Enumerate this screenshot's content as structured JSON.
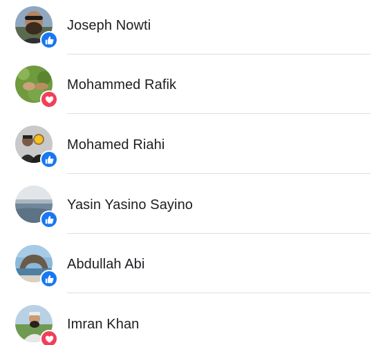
{
  "people": [
    {
      "name": "Joseph Nowti",
      "reaction": "like-icon"
    },
    {
      "name": "Mohammed Rafik",
      "reaction": "love-icon"
    },
    {
      "name": "Mohamed Riahi",
      "reaction": "like-icon"
    },
    {
      "name": "Yasin Yasino Sayino",
      "reaction": "like-icon"
    },
    {
      "name": "Abdullah Abi",
      "reaction": "like-icon"
    },
    {
      "name": "Imran Khan",
      "reaction": "love-icon"
    }
  ],
  "colors": {
    "like": "#1877f2",
    "love": "#f33e58",
    "divider": "#dadde1",
    "text": "#1c1e21"
  }
}
